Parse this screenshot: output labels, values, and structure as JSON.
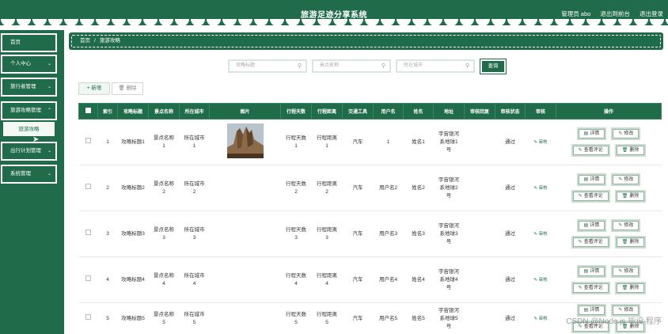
{
  "header": {
    "title": "旅游足迹分享系统",
    "user": "管理员 abo",
    "back_link": "退出到前台",
    "logout": "退出登录"
  },
  "sidebar": {
    "items": [
      {
        "label": "首页",
        "chevron": ""
      },
      {
        "label": "个人中心",
        "chevron": "⌄"
      },
      {
        "label": "旅行者管理",
        "chevron": "⌄"
      },
      {
        "label": "旅游攻略管理",
        "chevron": "⌃"
      },
      {
        "label": "出行计划管理",
        "chevron": "⌄"
      },
      {
        "label": "系统管理",
        "chevron": "⌄"
      }
    ],
    "active_sub": "旅游攻略"
  },
  "breadcrumb": {
    "home": "首页",
    "sep": "/",
    "current": "旅游攻略"
  },
  "search": {
    "title_placeholder": "攻略标题",
    "spot_placeholder": "景点名称",
    "city_placeholder": "所在城市",
    "button": "查询"
  },
  "actions": {
    "add": "新增",
    "delete": "删除"
  },
  "table": {
    "headers": [
      "",
      "索引",
      "攻略标题",
      "景点名称",
      "所在城市",
      "图片",
      "行程天数",
      "行程距离",
      "交通工具",
      "用户名",
      "姓名",
      "地址",
      "审核回复",
      "审核状态",
      "审核",
      "操作"
    ],
    "audit_label": "审核",
    "ops": {
      "detail": "详情",
      "edit": "修改",
      "comments": "查看评论",
      "delete": "删除"
    },
    "rows": [
      {
        "index": "1",
        "title": "攻略标题1",
        "spot": "景点名称\n1",
        "city": "所在城市\n1",
        "days": "行程天数\n1",
        "distance": "行程距离\n1",
        "transport": "汽车",
        "username": "1",
        "name": "姓名1",
        "address": "宇宙银河\n系地球1\n号",
        "reply": "",
        "status": "通过"
      },
      {
        "index": "2",
        "title": "攻略标题2",
        "spot": "景点名称\n2",
        "city": "所在城市\n2",
        "days": "行程天数\n2",
        "distance": "行程距离\n2",
        "transport": "汽车",
        "username": "用户名2",
        "name": "姓名2",
        "address": "宇宙银河\n系地球2\n号",
        "reply": "",
        "status": "通过"
      },
      {
        "index": "3",
        "title": "攻略标题3",
        "spot": "景点名称\n3",
        "city": "所在城市\n3",
        "days": "行程天数\n3",
        "distance": "行程距离\n3",
        "transport": "汽车",
        "username": "用户名3",
        "name": "姓名3",
        "address": "宇宙银河\n系地球3\n号",
        "reply": "",
        "status": "通过"
      },
      {
        "index": "4",
        "title": "攻略标题4",
        "spot": "景点名称\n4",
        "city": "所在城市\n4",
        "days": "行程天数\n4",
        "distance": "行程距离\n4",
        "transport": "汽车",
        "username": "用户名4",
        "name": "姓名4",
        "address": "宇宙银河\n系地球4\n号",
        "reply": "",
        "status": "通过"
      },
      {
        "index": "5",
        "title": "攻略标题5",
        "spot": "景点名称\n5",
        "city": "所在城市\n5",
        "days": "行程天数\n5",
        "distance": "行程距离\n5",
        "transport": "汽车",
        "username": "用户名5",
        "name": "姓名5",
        "address": "宇宙银河\n系地球5\n号",
        "reply": "",
        "status": "通过"
      }
    ]
  },
  "watermark": "CSDN @Node.js 毕设 程序",
  "colors": {
    "primary": "#1f6b4a",
    "accent_light": "#f0f7f3"
  }
}
